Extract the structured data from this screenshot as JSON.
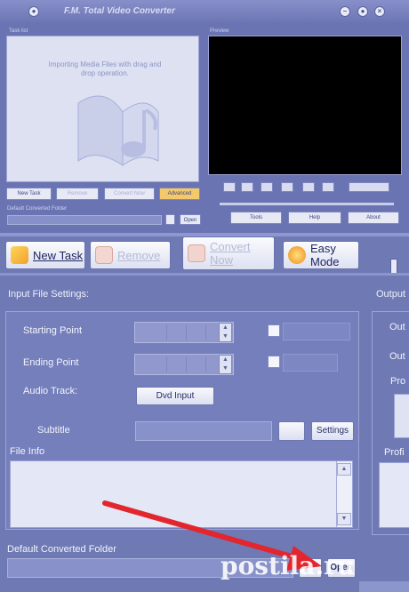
{
  "thumb": {
    "title": "F.M. Total Video Converter",
    "hint": "Importing Media Files with drag and drop operation.",
    "left_panel_label": "Task list",
    "right_panel_label": "Preview",
    "new_task": "New Task",
    "remove": "Remove",
    "convert_now": "Convert Now",
    "advanced": "Advanced",
    "default_folder": "Default Converted Folder",
    "open": "Open",
    "tools": "Tools",
    "help": "Help",
    "about": "About"
  },
  "toolbar": {
    "new_task": "New Task",
    "remove": "Remove",
    "convert_now": "Convert Now",
    "easy_mode": "Easy Mode"
  },
  "input_settings": {
    "heading": "Input File Settings:",
    "starting_point": "Starting Point",
    "ending_point": "Ending Point",
    "audio_track": "Audio Track:",
    "dvd_input": "Dvd Input",
    "subtitle": "Subtitle",
    "settings": "Settings",
    "file_info": "File Info"
  },
  "output_settings": {
    "heading": "Output",
    "row1": "Out",
    "row2": "Out",
    "row3": "Pro",
    "row4": "Profi"
  },
  "footer": {
    "default_folder": "Default Converted Folder",
    "open": "Open"
  },
  "watermark": "postila.ru",
  "colors": {
    "window_bg": "#6f79b4",
    "panel_border": "#9ba3d6",
    "arrow": "#e3262e"
  },
  "icons": {
    "new_task": "add-files-icon",
    "remove": "remove-icon",
    "convert_now": "convert-icon",
    "easy_mode": "mode-icon"
  }
}
